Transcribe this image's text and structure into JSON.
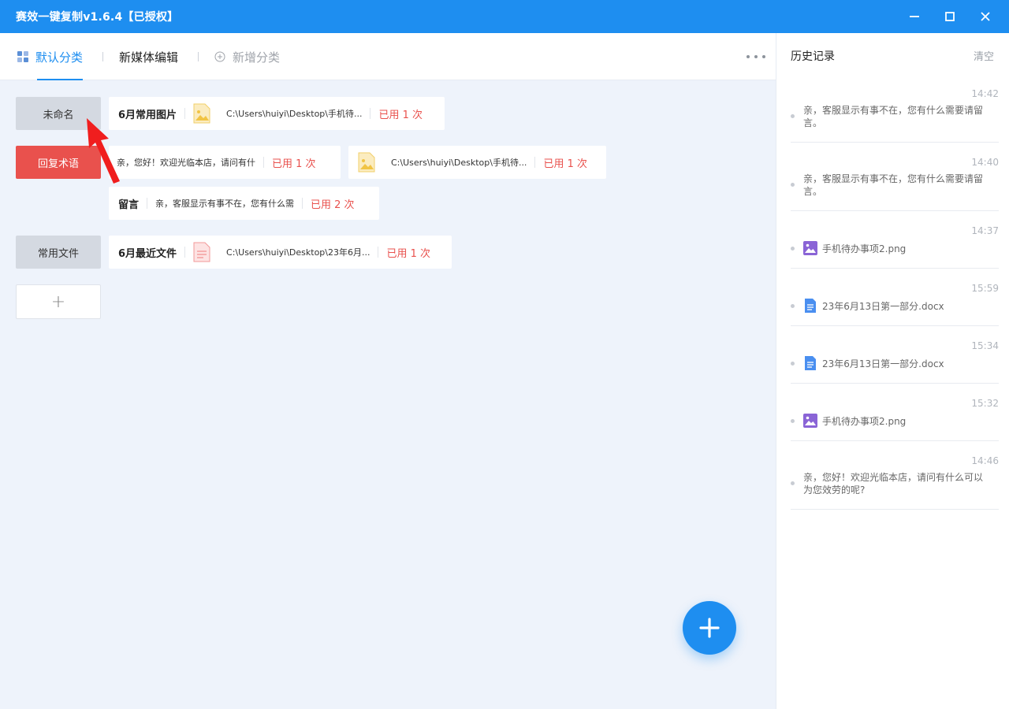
{
  "window": {
    "title": "赛效一键复制v1.6.4【已授权】"
  },
  "tabs": {
    "default_label": "默认分类",
    "media_label": "新媒体编辑",
    "add_label": "新增分类"
  },
  "categories": [
    {
      "label": "未命名",
      "items": [
        {
          "name": "6月常用图片",
          "path": "C:\\Users\\huiyi\\Desktop\\手机待...",
          "used": "已用 1 次",
          "icon": "image-file-icon"
        }
      ]
    },
    {
      "label": "回复术语",
      "items": [
        {
          "text": "亲，您好！欢迎光临本店，请问有什",
          "used": "已用 1 次"
        },
        {
          "path": "C:\\Users\\huiyi\\Desktop\\手机待...",
          "used": "已用 1 次",
          "icon": "image-file-icon"
        },
        {
          "name": "留言",
          "text": "亲，客服显示有事不在，您有什么需",
          "used": "已用 2 次"
        }
      ]
    },
    {
      "label": "常用文件",
      "items": [
        {
          "name": "6月最近文件",
          "path": "C:\\Users\\huiyi\\Desktop\\23年6月...",
          "used": "已用 1 次",
          "icon": "document-file-icon"
        }
      ]
    }
  ],
  "add_category_label": "+",
  "history": {
    "title": "历史记录",
    "clear_label": "清空",
    "entries": [
      {
        "time": "14:42",
        "text": "亲，客服显示有事不在，您有什么需要请留言。"
      },
      {
        "time": "14:40",
        "text": "亲，客服显示有事不在，您有什么需要请留言。"
      },
      {
        "time": "14:37",
        "file": "手机待办事项2.png",
        "icon": "image-icon"
      },
      {
        "time": "15:59",
        "file": "23年6月13日第一部分.docx",
        "icon": "doc-icon"
      },
      {
        "time": "15:34",
        "file": "23年6月13日第一部分.docx",
        "icon": "doc-icon"
      },
      {
        "time": "15:32",
        "file": "手机待办事项2.png",
        "icon": "image-icon"
      },
      {
        "time": "14:46",
        "text": "亲，您好！欢迎光临本店，请问有什么可以为您效劳的呢?"
      }
    ]
  },
  "colors": {
    "accent": "#1e8ef0",
    "danger": "#e9514d",
    "background": "#eef3fb"
  }
}
